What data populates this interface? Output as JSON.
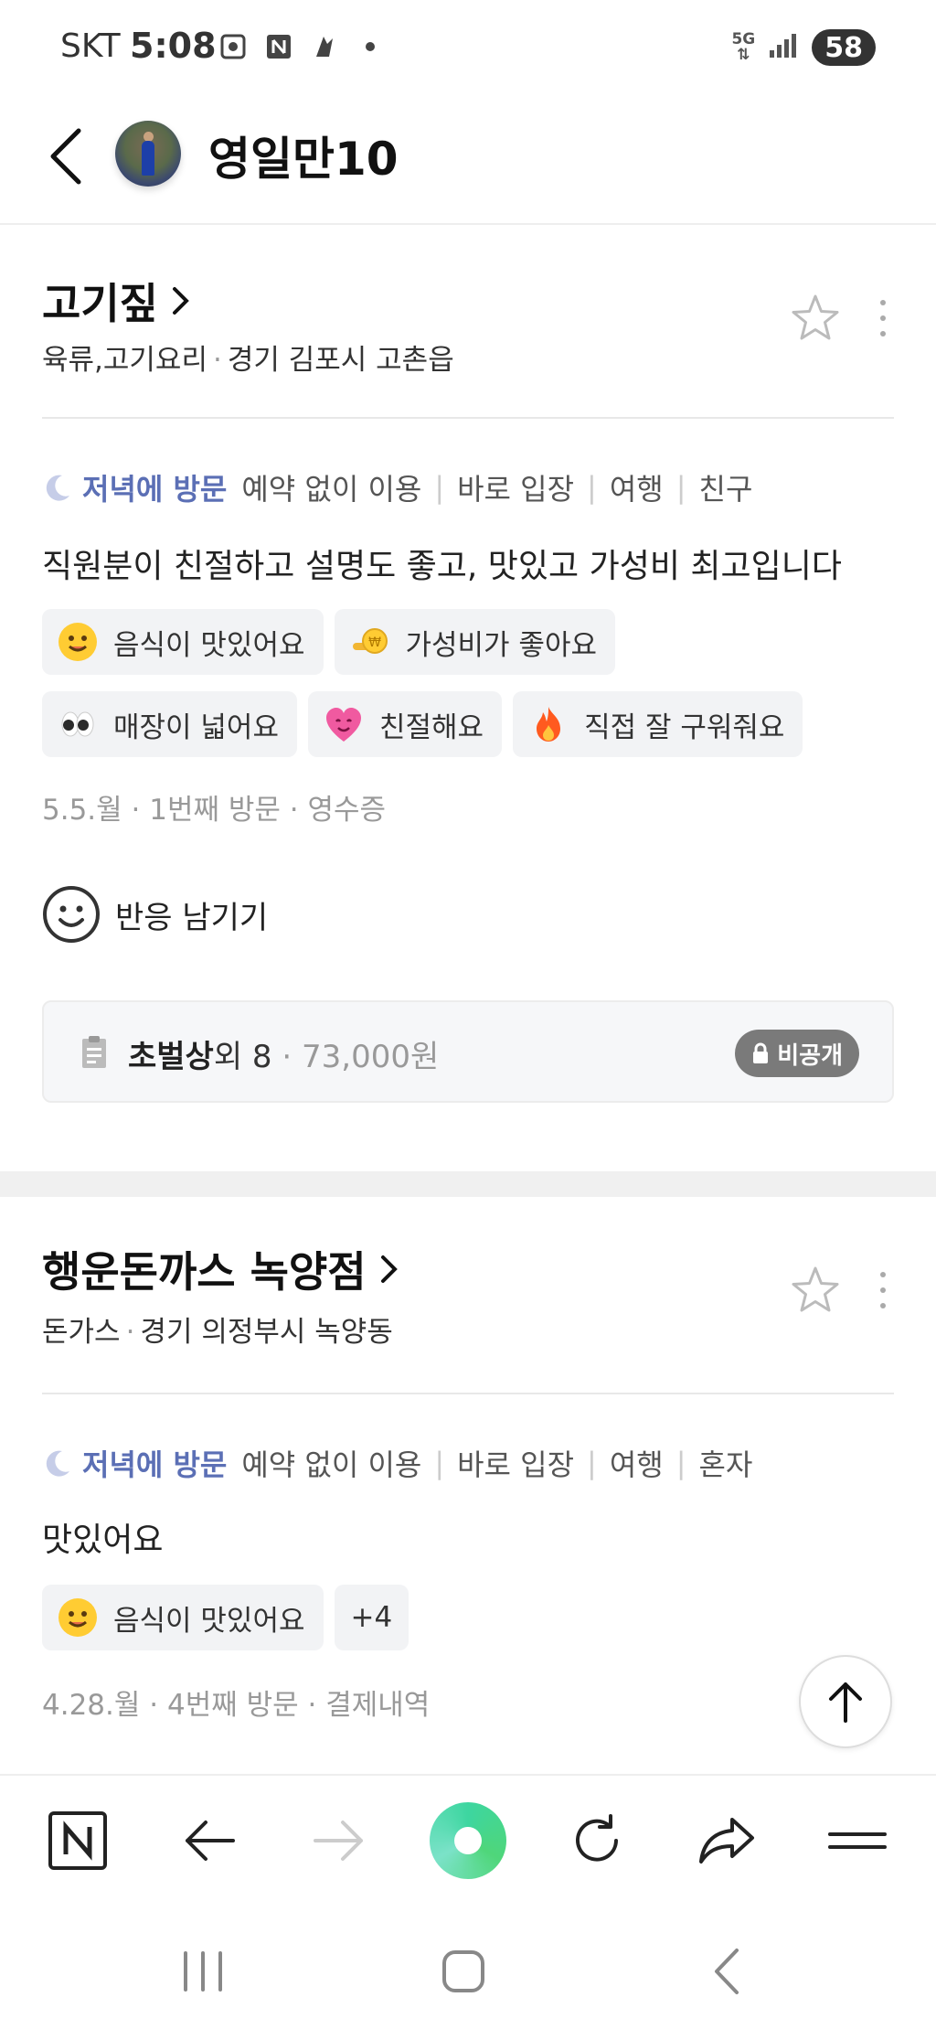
{
  "status_bar": {
    "carrier": "SKT",
    "time": "5:08",
    "network": "5G",
    "battery": "58"
  },
  "header": {
    "profile_name": "영일만10"
  },
  "reviews": [
    {
      "place_name": "고기짚",
      "category": "육류,고기요리",
      "location": "경기 김포시 고촌읍",
      "visit_time": "저녁에 방문",
      "visit_tags": [
        "예약 없이 이용",
        "바로 입장",
        "여행",
        "친구"
      ],
      "text": "직원분이 친절하고 설명도 좋고, 맛있고 가성비 최고입니다",
      "keywords": [
        "음식이 맛있어요",
        "가성비가 좋아요",
        "매장이 넓어요",
        "친절해요",
        "직접 잘 구워줘요"
      ],
      "date": "5.5.월",
      "visit_count": "1번째 방문",
      "verify": "영수증",
      "react_label": "반응 남기기",
      "receipt": {
        "item": "초벌상",
        "extra": "외 8",
        "price": "73,000원",
        "badge": "비공개"
      }
    },
    {
      "place_name": "행운돈까스 녹양점",
      "category": "돈가스",
      "location": "경기 의정부시 녹양동",
      "visit_time": "저녁에 방문",
      "visit_tags": [
        "예약 없이 이용",
        "바로 입장",
        "여행",
        "혼자"
      ],
      "text": "맛있어요",
      "keywords": [
        "음식이 맛있어요"
      ],
      "keywords_more": "+4",
      "date": "4.28.월",
      "visit_count": "4번째 방문",
      "verify": "결제내역"
    }
  ],
  "icons": {
    "back": "chevron-left-icon",
    "star": "star-outline-icon",
    "more": "more-vertical-icon",
    "moon": "moon-icon",
    "smile": "smile-icon",
    "lock": "lock-icon",
    "receipt": "receipt-icon",
    "scroll_top": "arrow-up-icon"
  },
  "colors": {
    "visit_time": "#5b6fb5",
    "badge_bg": "#7a7a7a",
    "tag_bg": "#f2f3f5",
    "naver_green": "#3dd6a0"
  }
}
